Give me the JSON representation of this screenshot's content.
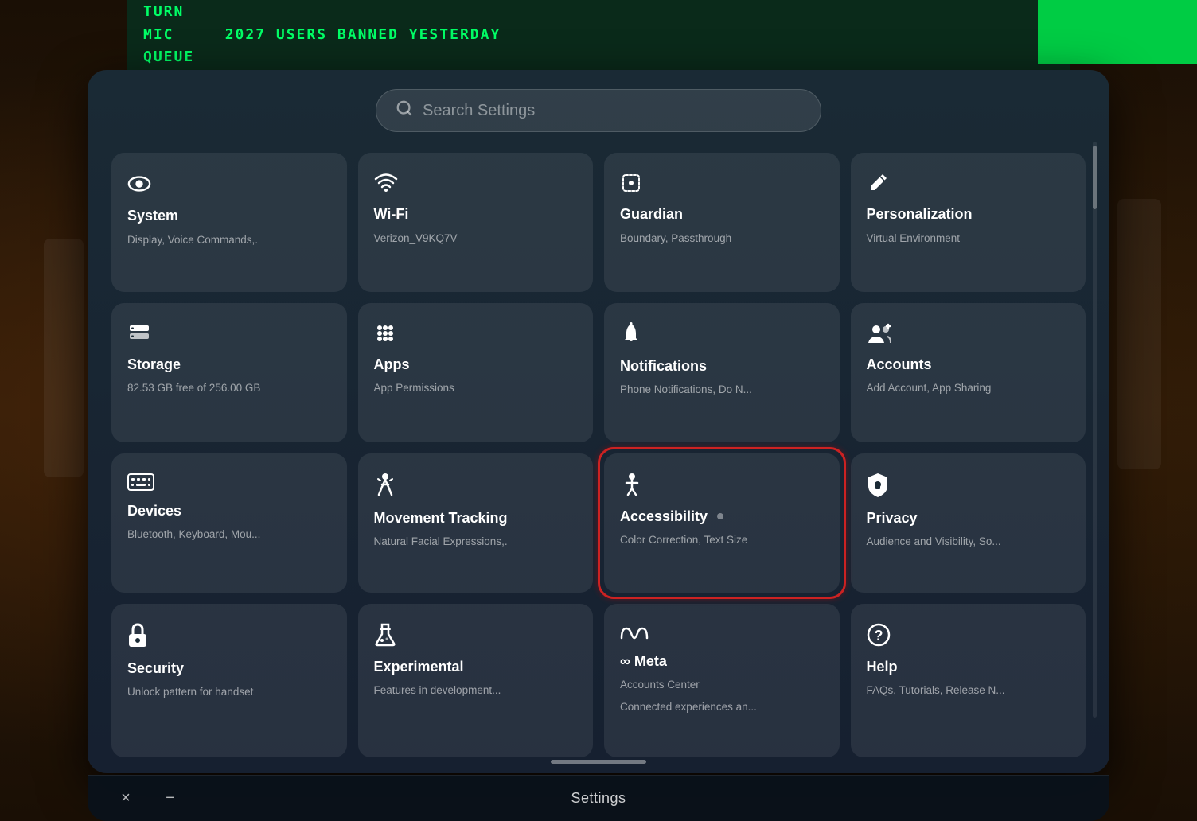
{
  "background": {
    "color": "#2a1a0e"
  },
  "top_banner": {
    "lines": [
      "TURN",
      "MIC    2027 USERS BANNED YESTERDAY",
      "QUEUE"
    ]
  },
  "search": {
    "placeholder": "Search Settings"
  },
  "grid": {
    "cards": [
      {
        "id": "system",
        "icon": "⬭",
        "title": "System",
        "subtitle": "Display, Voice Commands,.",
        "highlighted": false
      },
      {
        "id": "wifi",
        "icon": "wifi",
        "title": "Wi-Fi",
        "subtitle": "Verizon_V9KQ7V",
        "highlighted": false
      },
      {
        "id": "guardian",
        "icon": "guardian",
        "title": "Guardian",
        "subtitle": "Boundary, Passthrough",
        "highlighted": false
      },
      {
        "id": "personalization",
        "icon": "pencil",
        "title": "Personalization",
        "subtitle": "Virtual Environment",
        "highlighted": false
      },
      {
        "id": "storage",
        "icon": "storage",
        "title": "Storage",
        "subtitle": "82.53 GB free of 256.00 GB",
        "highlighted": false
      },
      {
        "id": "apps",
        "icon": "apps",
        "title": "Apps",
        "subtitle": "App Permissions",
        "highlighted": false
      },
      {
        "id": "notifications",
        "icon": "bell",
        "title": "Notifications",
        "subtitle": "Phone Notifications, Do N...",
        "highlighted": false
      },
      {
        "id": "accounts",
        "icon": "accounts",
        "title": "Accounts",
        "subtitle": "Add Account, App Sharing",
        "highlighted": false
      },
      {
        "id": "devices",
        "icon": "keyboard",
        "title": "Devices",
        "subtitle": "Bluetooth, Keyboard, Mou...",
        "highlighted": false
      },
      {
        "id": "movement",
        "icon": "movement",
        "title": "Movement Tracking",
        "subtitle": "Natural Facial Expressions,.",
        "highlighted": false
      },
      {
        "id": "accessibility",
        "icon": "accessibility",
        "title": "Accessibility",
        "subtitle": "Color Correction, Text Size",
        "highlighted": true,
        "annotated": true
      },
      {
        "id": "privacy",
        "icon": "shield",
        "title": "Privacy",
        "subtitle": "Audience and Visibility, So...",
        "highlighted": false
      },
      {
        "id": "security",
        "icon": "lock",
        "title": "Security",
        "subtitle": "Unlock pattern for handset",
        "highlighted": false
      },
      {
        "id": "experimental",
        "icon": "experimental",
        "title": "Experimental",
        "subtitle": "Features in development...",
        "highlighted": false
      },
      {
        "id": "meta",
        "icon": "meta",
        "title": "Meta",
        "subtitle": "Accounts Center\nConnected experiences an...",
        "highlighted": false
      },
      {
        "id": "help",
        "icon": "help",
        "title": "Help",
        "subtitle": "FAQs, Tutorials, Release N...",
        "highlighted": false
      }
    ]
  },
  "bottom_bar": {
    "title": "Settings",
    "close_label": "×",
    "minimize_label": "−"
  }
}
